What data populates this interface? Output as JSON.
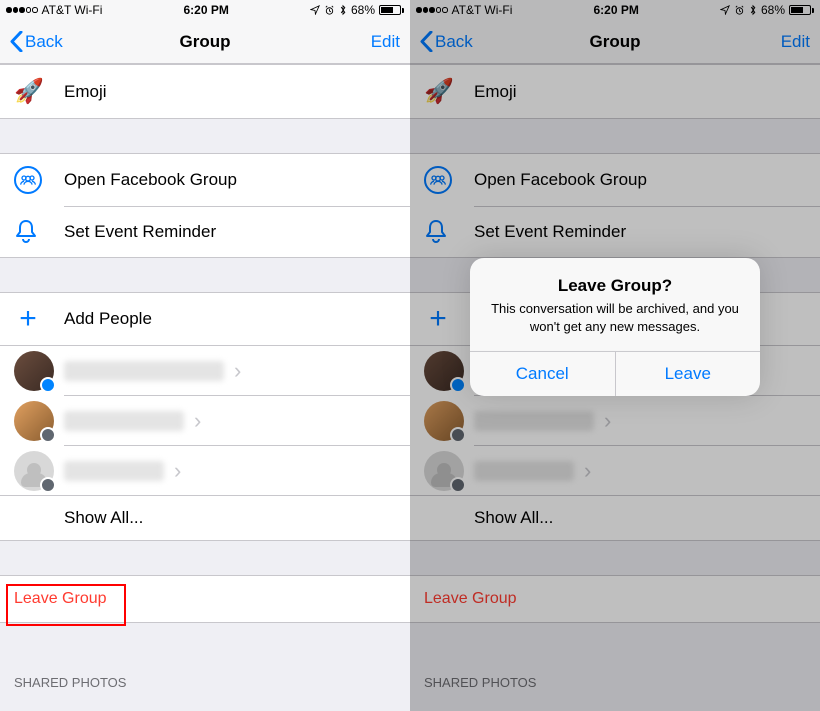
{
  "statusbar": {
    "carrier": "AT&T Wi-Fi",
    "time": "6:20 PM",
    "battery_pct": "68%"
  },
  "nav": {
    "back": "Back",
    "title": "Group",
    "edit": "Edit"
  },
  "rows": {
    "emoji": "Emoji",
    "open_fb_group": "Open Facebook Group",
    "set_event_reminder": "Set Event Reminder",
    "add_people": "Add People",
    "show_all": "Show All...",
    "leave_group": "Leave Group",
    "shared_photos": "SHARED PHOTOS"
  },
  "alert": {
    "title": "Leave Group?",
    "message": "This conversation will be archived, and you won't get any new messages.",
    "cancel": "Cancel",
    "leave": "Leave"
  }
}
